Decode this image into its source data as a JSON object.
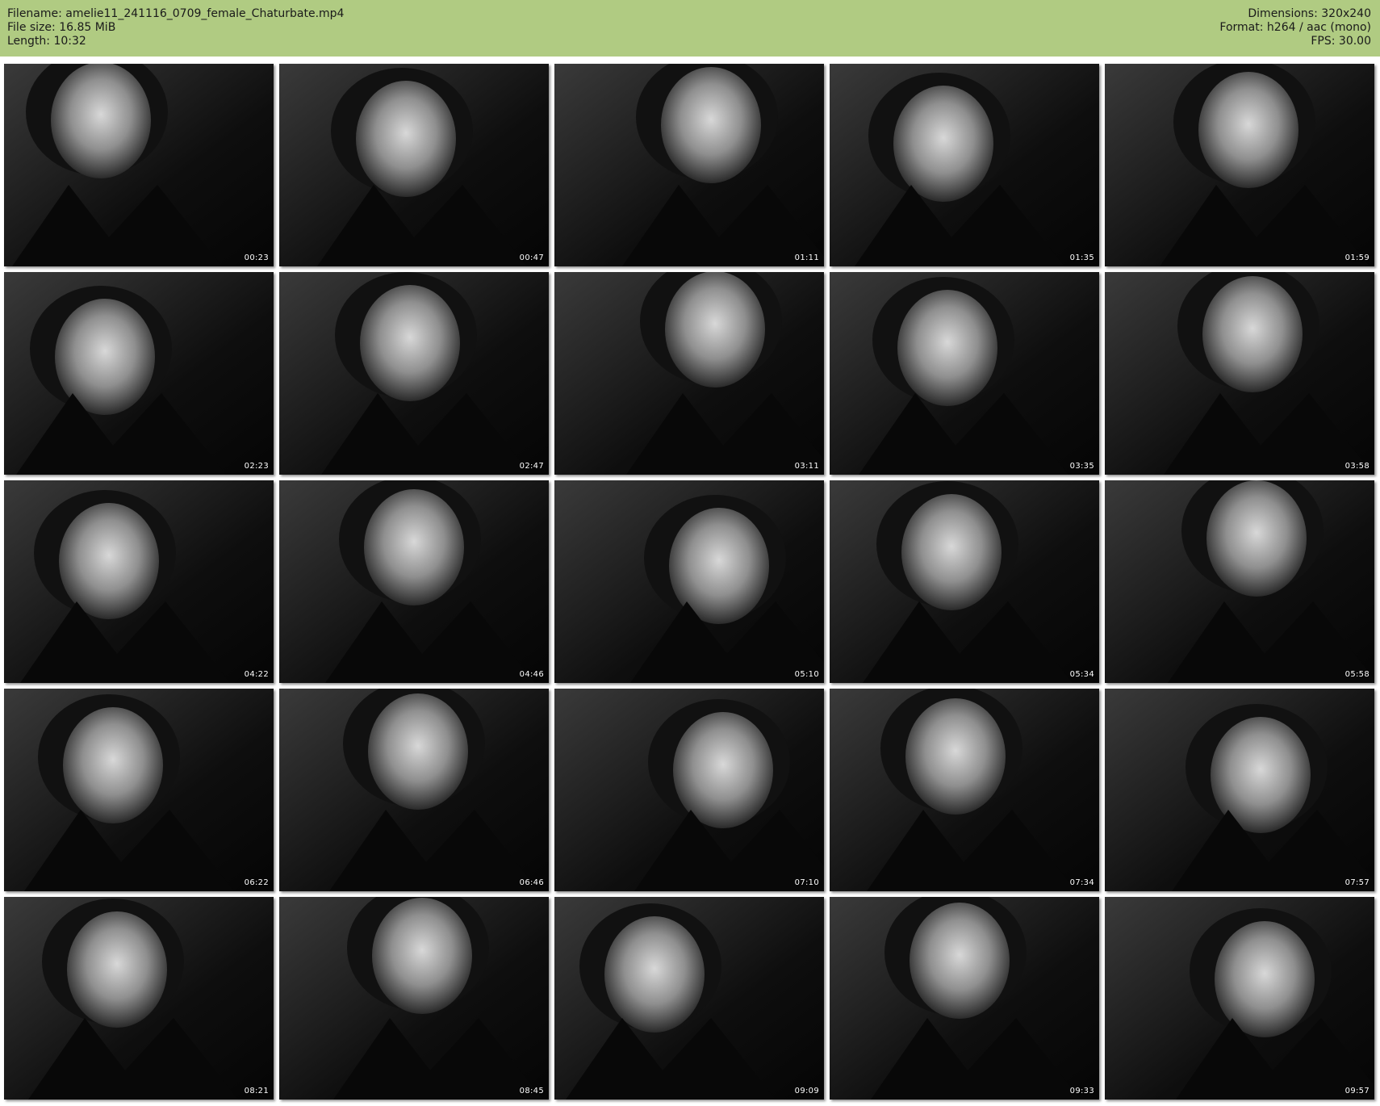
{
  "header": {
    "filename_line": "Filename: amelie11_241116_0709_female_Chaturbate.mp4",
    "filesize_line": "File size: 16.85 MiB",
    "length_line": "Length: 10:32",
    "dimensions_line": "Dimensions: 320x240",
    "format_line": "Format: h264 / aac (mono)",
    "fps_line": "FPS: 30.00"
  },
  "colors": {
    "header_bg": "#b0cb82",
    "page_bg": "#ffffff"
  },
  "thumbnails": [
    {
      "time": "00:23"
    },
    {
      "time": "00:47"
    },
    {
      "time": "01:11"
    },
    {
      "time": "01:35"
    },
    {
      "time": "01:59"
    },
    {
      "time": "02:23"
    },
    {
      "time": "02:47"
    },
    {
      "time": "03:11"
    },
    {
      "time": "03:35"
    },
    {
      "time": "03:58"
    },
    {
      "time": "04:22"
    },
    {
      "time": "04:46"
    },
    {
      "time": "05:10"
    },
    {
      "time": "05:34"
    },
    {
      "time": "05:58"
    },
    {
      "time": "06:22"
    },
    {
      "time": "06:46"
    },
    {
      "time": "07:10"
    },
    {
      "time": "07:34"
    },
    {
      "time": "07:57"
    },
    {
      "time": "08:21"
    },
    {
      "time": "08:45"
    },
    {
      "time": "09:09"
    },
    {
      "time": "09:33"
    },
    {
      "time": "09:57"
    }
  ]
}
